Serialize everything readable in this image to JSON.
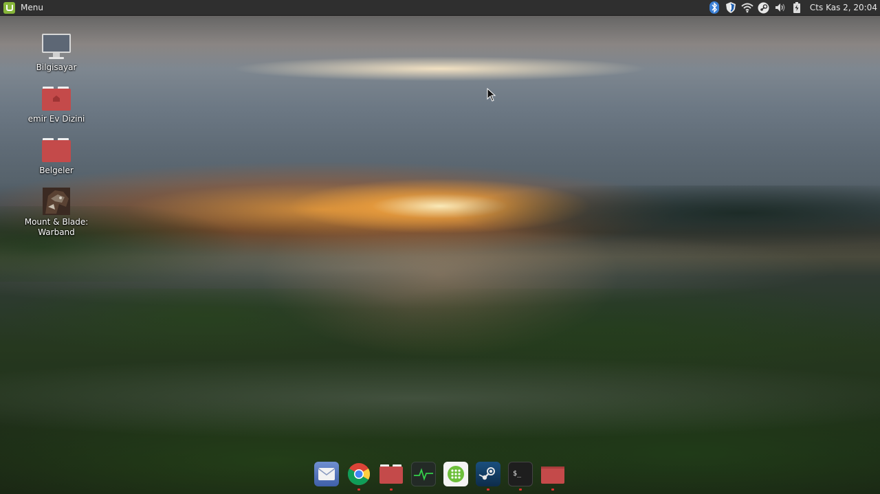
{
  "panel": {
    "menu_label": "Menu",
    "clock": "Cts Kas  2, 20:04",
    "tray_icons": [
      "bluetooth-icon",
      "shield-icon",
      "wifi-icon",
      "steam-tray-icon",
      "volume-icon",
      "battery-icon"
    ]
  },
  "desktop": {
    "icons": [
      {
        "label": "Bilgisayar",
        "icon": "computer-icon"
      },
      {
        "label": "emir Ev Dizini",
        "icon": "home-folder-icon"
      },
      {
        "label": "Belgeler",
        "icon": "folder-icon"
      },
      {
        "label": "Mount & Blade: Warband",
        "icon": "game-icon"
      }
    ]
  },
  "dock": {
    "items": [
      {
        "name": "mail",
        "icon": "mail-icon",
        "running": false
      },
      {
        "name": "chrome",
        "icon": "chrome-icon",
        "running": true
      },
      {
        "name": "files",
        "icon": "folder-icon",
        "running": true
      },
      {
        "name": "system-monitor",
        "icon": "system-monitor-icon",
        "running": false
      },
      {
        "name": "app-grid",
        "icon": "app-grid-icon",
        "running": false
      },
      {
        "name": "steam",
        "icon": "steam-icon",
        "running": true
      },
      {
        "name": "terminal",
        "icon": "terminal-icon",
        "running": true
      },
      {
        "name": "folder",
        "icon": "folder-icon",
        "running": true
      }
    ]
  },
  "colors": {
    "panel": "#2f2f2f",
    "mint_green": "#87b63a",
    "folder_red": "#c44a4a",
    "running_dot": "#e03030"
  }
}
